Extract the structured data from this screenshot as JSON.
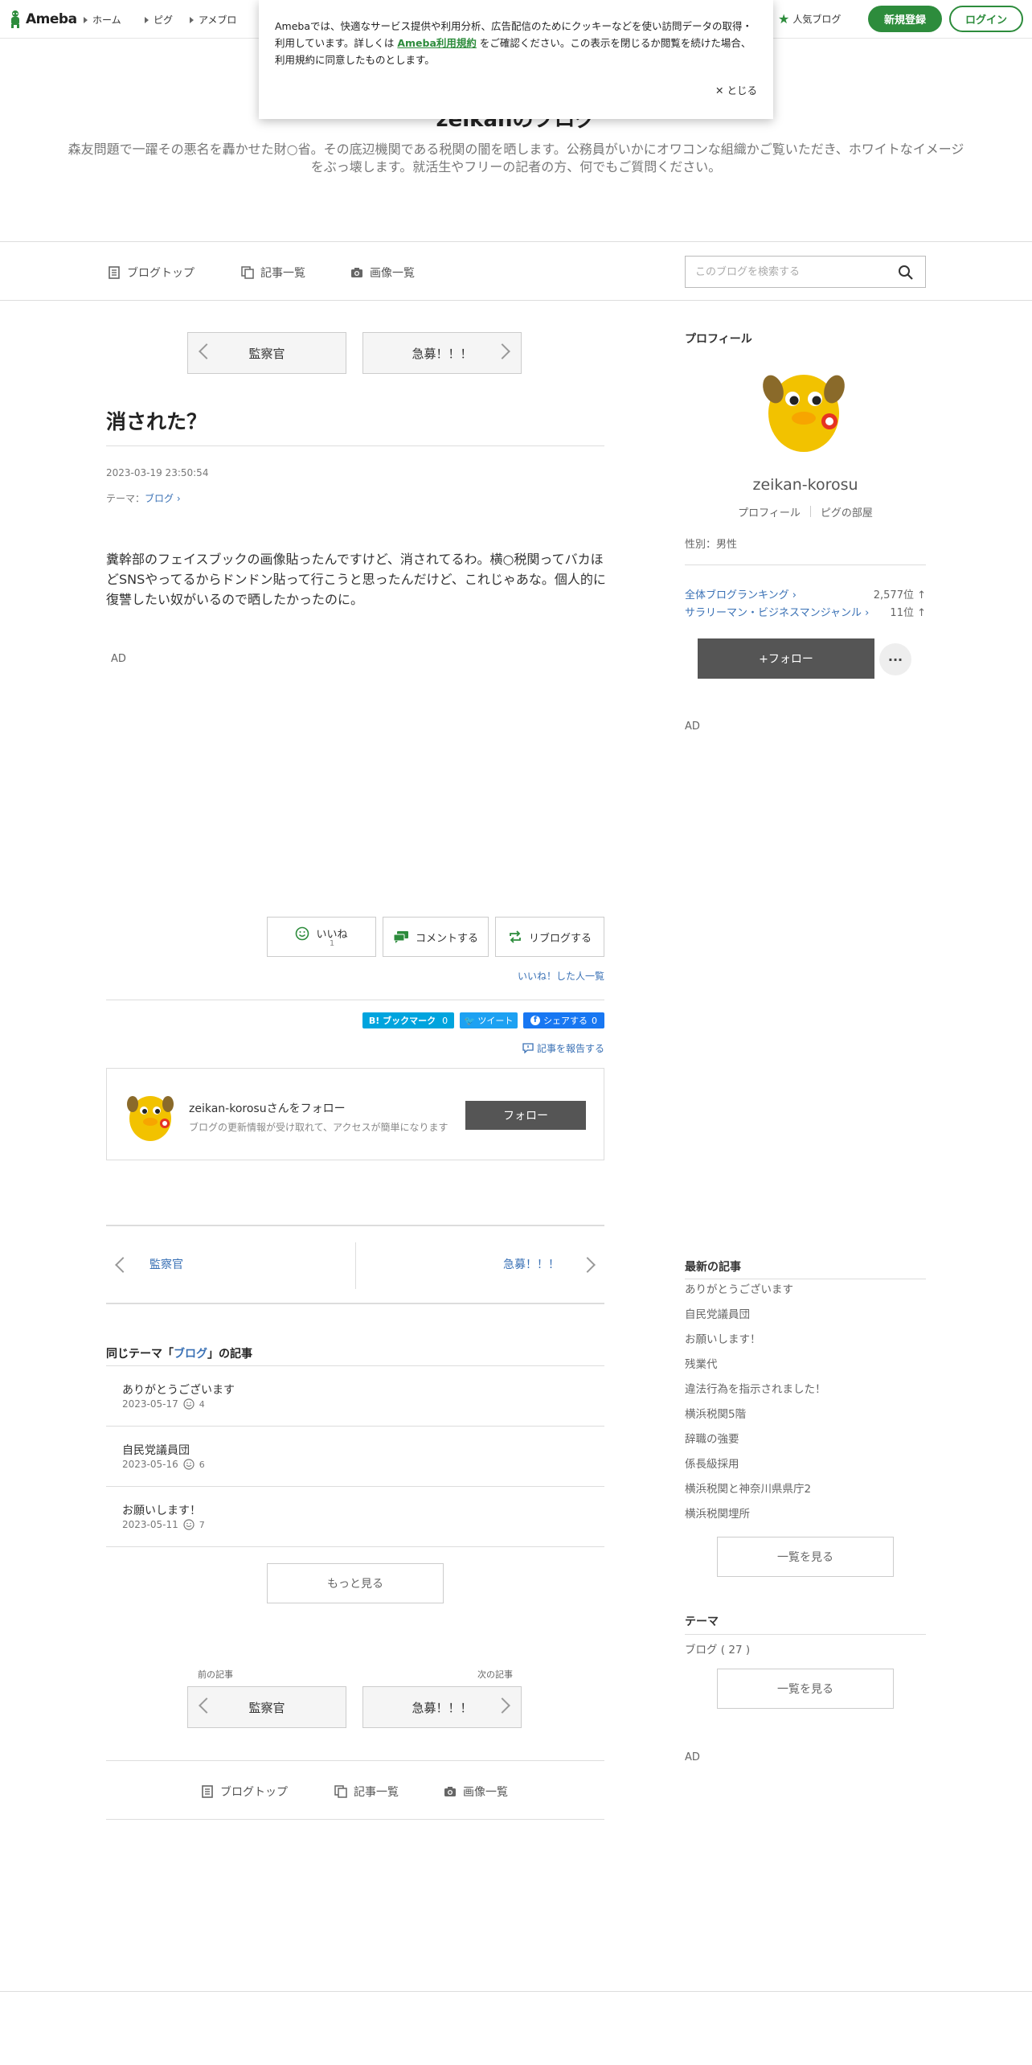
{
  "header": {
    "logo_text": "Ameba",
    "nav": [
      "ホーム",
      "ピグ",
      "アメブロ"
    ],
    "popular": "人気ブログ",
    "register": "新規登録",
    "login": "ログイン"
  },
  "cookie": {
    "text_before": "Amebaでは、快適なサービス提供や利用分析、広告配信のためにクッキーなどを使い訪問データの取得・利用しています。詳しくは ",
    "link": "Ameba利用規約",
    "text_after": " をご確認ください。この表示を閉じるか閲覧を続けた場合、利用規約に同意したものとします。",
    "close": "とじる"
  },
  "blog": {
    "title": "zeikanのブログ",
    "description": "森友問題で一躍その悪名を轟かせた財○省。その底辺機関である税関の闇を晒します。公務員がいかにオワコンな組織かご覧いただき、ホワイトなイメージをぶっ壊します。就活生やフリーの記者の方、何でもご質問ください。"
  },
  "blognav": {
    "top": "ブログトップ",
    "list": "記事一覧",
    "images": "画像一覧",
    "search_placeholder": "このブログを検索する"
  },
  "nav_buttons": {
    "prev": "監察官",
    "next": "急募！！！",
    "prev_label": "前の記事",
    "next_label": "次の記事"
  },
  "article": {
    "title": "消された？",
    "date": "2023-03-19 23:50:54",
    "theme_label": "テーマ：",
    "theme": "ブログ",
    "body": "糞幹部のフェイスブックの画像貼ったんですけど、消されてるわ。横○税関ってバカほどSNSやってるからドンドン貼って行こうと思ったんだけど、これじゃあな。個人的に復讐したい奴がいるので晒したかったのに。",
    "ad": "AD"
  },
  "actions": {
    "like": "いいね",
    "like_count": "1",
    "comment": "コメントする",
    "reblog": "リブログする",
    "likers": "いいね！した人一覧",
    "bookmark": "B! ブックマーク",
    "bookmark_count": "0",
    "tweet": "ツイート",
    "fb_share": "シェアする",
    "fb_count": "0",
    "report": "記事を報告する"
  },
  "follow_box": {
    "name": "zeikan-korosuさんをフォロー",
    "sub": "ブログの更新情報が受け取れて、アクセスが簡単になります",
    "button": "フォロー"
  },
  "pager": {
    "prev": "監察官",
    "next": "急募！！！"
  },
  "same_theme": {
    "prefix": "同じテーマ「",
    "theme": "ブログ",
    "suffix": "」の記事",
    "items": [
      {
        "title": "ありがとうございます",
        "date": "2023-05-17",
        "likes": "4"
      },
      {
        "title": "自民党議員団",
        "date": "2023-05-16",
        "likes": "6"
      },
      {
        "title": "お願いします！",
        "date": "2023-05-11",
        "likes": "7"
      }
    ],
    "more": "もっと見る"
  },
  "sidebar": {
    "profile_heading": "プロフィール",
    "name": "zeikan-korosu",
    "profile_link": "プロフィール",
    "pig_link": "ピグの部屋",
    "gender": "性別：男性",
    "rankings": [
      {
        "label": "全体ブログランキング",
        "value": "2,577位 ↑"
      },
      {
        "label": "サラリーマン・ビジネスマンジャンル",
        "value": "11位 ↑"
      }
    ],
    "follow": "+フォロー",
    "more": "···",
    "ad": "AD",
    "recent_heading": "最新の記事",
    "recent": [
      "ありがとうございます",
      "自民党議員団",
      "お願いします！",
      "残業代",
      "違法行為を指示されました！",
      "横浜税関5階",
      "辞職の強要",
      "係長級採用",
      "横浜税関と神奈川県県庁2",
      "横浜税関埋所"
    ],
    "recent_more": "一覧を見る",
    "theme_heading": "テーマ",
    "theme_item": "ブログ ( 27 )",
    "theme_more": "一覧を見る",
    "ad2": "AD"
  },
  "colors": {
    "brand_green": "#2d8c3c",
    "link_blue": "#3a71b5",
    "follow_gray": "#555555"
  }
}
